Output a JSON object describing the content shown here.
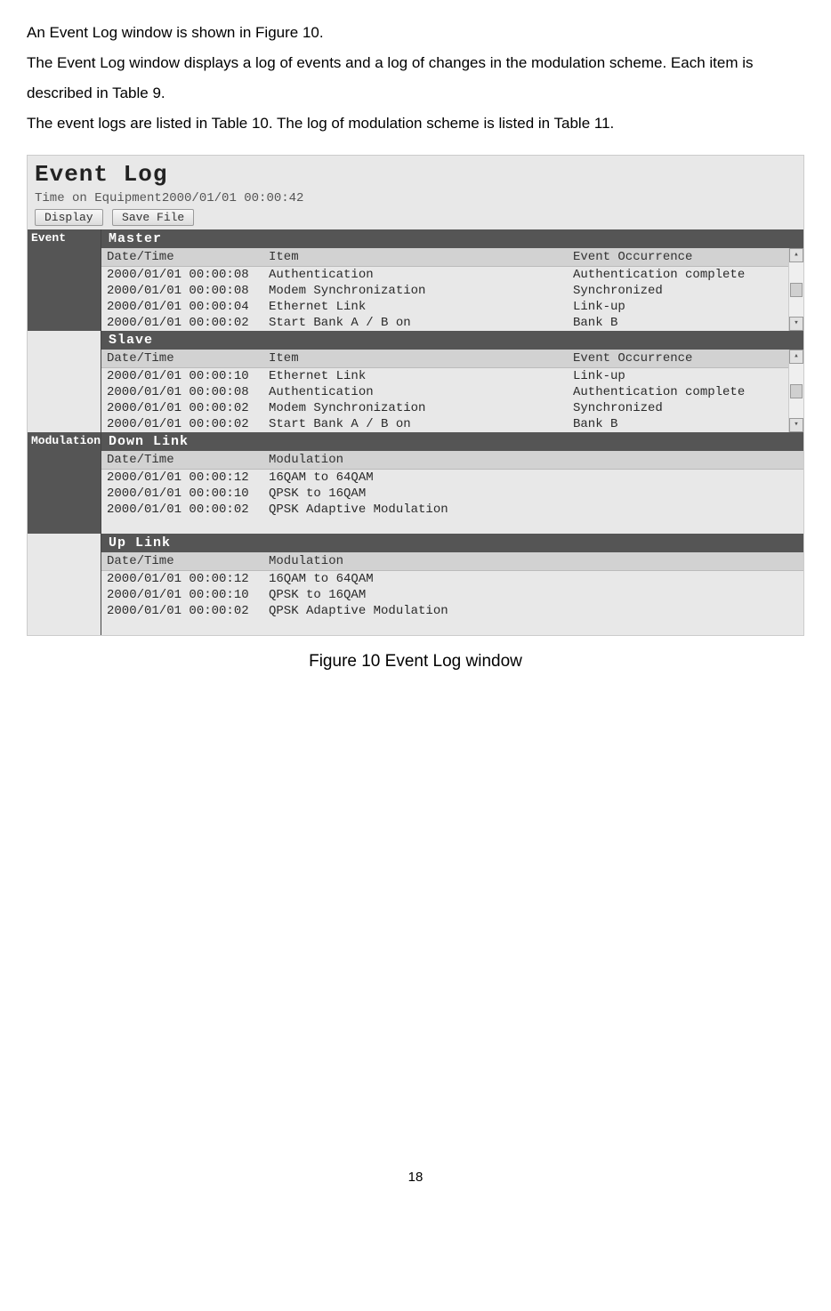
{
  "intro": {
    "p1": "An Event Log window is shown in Figure 10.",
    "p2": "The Event Log window displays a log of events and a log of changes in the modulation scheme. Each item is described in Table 9.",
    "p3": "The event logs are listed in Table 10. The log of modulation scheme is listed in Table 11."
  },
  "figure": {
    "title": "Event Log",
    "timeLabel": "Time on Equipment",
    "timeValue": "2000/01/01 00:00:42",
    "buttons": {
      "display": "Display",
      "saveFile": "Save File"
    },
    "sideLabels": {
      "event": "Event",
      "modulation": "Modulation"
    },
    "eventCols": [
      "Date/Time",
      "Item",
      "Event Occurrence"
    ],
    "modCols": [
      "Date/Time",
      "Modulation"
    ],
    "groups": {
      "master": "Master",
      "slave": "Slave",
      "downlink": "Down Link",
      "uplink": "Up Link"
    },
    "masterRows": [
      {
        "dt": "2000/01/01 00:00:08",
        "item": "Authentication",
        "evt": "Authentication complete"
      },
      {
        "dt": "2000/01/01 00:00:08",
        "item": "Modem Synchronization",
        "evt": "Synchronized"
      },
      {
        "dt": "2000/01/01 00:00:04",
        "item": "Ethernet Link",
        "evt": "Link-up"
      },
      {
        "dt": "2000/01/01 00:00:02",
        "item": "Start Bank A / B on",
        "evt": "Bank B"
      }
    ],
    "slaveRows": [
      {
        "dt": "2000/01/01 00:00:10",
        "item": "Ethernet Link",
        "evt": "Link-up"
      },
      {
        "dt": "2000/01/01 00:00:08",
        "item": "Authentication",
        "evt": "Authentication complete"
      },
      {
        "dt": "2000/01/01 00:00:02",
        "item": "Modem Synchronization",
        "evt": "Synchronized"
      },
      {
        "dt": "2000/01/01 00:00:02",
        "item": "Start Bank A / B on",
        "evt": "Bank B"
      }
    ],
    "downlinkRows": [
      {
        "dt": "2000/01/01 00:00:12",
        "mod": "16QAM to 64QAM"
      },
      {
        "dt": "2000/01/01 00:00:10",
        "mod": "QPSK to 16QAM"
      },
      {
        "dt": "2000/01/01 00:00:02",
        "mod": "QPSK Adaptive Modulation"
      }
    ],
    "uplinkRows": [
      {
        "dt": "2000/01/01 00:00:12",
        "mod": "16QAM to 64QAM"
      },
      {
        "dt": "2000/01/01 00:00:10",
        "mod": "QPSK to 16QAM"
      },
      {
        "dt": "2000/01/01 00:00:02",
        "mod": "QPSK Adaptive Modulation"
      }
    ]
  },
  "caption": "Figure 10 Event Log window",
  "pageNumber": "18"
}
